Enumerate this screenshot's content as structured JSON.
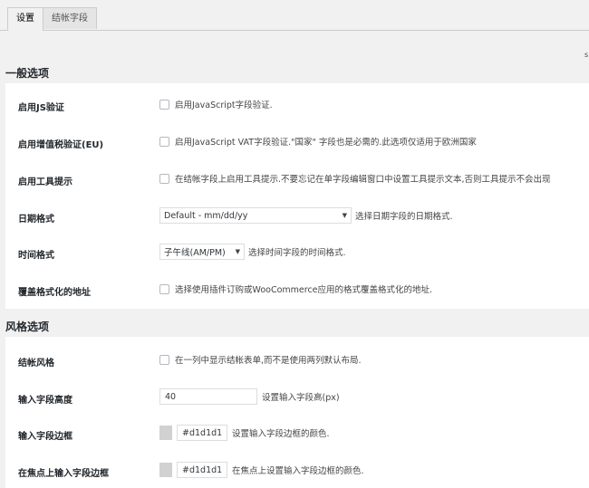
{
  "tabs": [
    {
      "label": "设置",
      "active": true
    },
    {
      "label": "结帐字段",
      "active": false
    }
  ],
  "stray_char": "s",
  "sections": [
    {
      "title": "一般选项",
      "rows": [
        {
          "label": "启用JS验证",
          "type": "checkbox",
          "checked": false,
          "desc": "启用JavaScript字段验证."
        },
        {
          "label": "启用增值税验证(EU)",
          "type": "checkbox",
          "checked": false,
          "desc": "启用JavaScript VAT字段验证.\"国家\" 字段也是必需的.此选项仅适用于欧洲国家"
        },
        {
          "label": "启用工具提示",
          "type": "checkbox",
          "checked": false,
          "desc": "在结帐字段上启用工具提示.不要忘记在单字段编辑窗口中设置工具提示文本,否则工具提示不会出现"
        },
        {
          "label": "日期格式",
          "type": "select",
          "value": "Default - mm/dd/yy",
          "desc": "选择日期字段的日期格式."
        },
        {
          "label": "时间格式",
          "type": "select",
          "value": "子午线(AM/PM)",
          "desc": "选择时间字段的时间格式."
        },
        {
          "label": "覆盖格式化的地址",
          "type": "checkbox",
          "checked": false,
          "desc": "选择使用插件订购或WooCommerce应用的格式覆盖格式化的地址."
        }
      ]
    },
    {
      "title": "风格选项",
      "rows": [
        {
          "label": "结帐风格",
          "type": "checkbox",
          "checked": false,
          "desc": "在一列中显示结帐表单,而不是使用两列默认布局."
        },
        {
          "label": "输入字段高度",
          "type": "input",
          "value": "40",
          "desc": "设置输入字段高(px)"
        },
        {
          "label": "输入字段边框",
          "type": "color",
          "value": "#d1d1d1",
          "desc": "设置输入字段边框的颜色."
        },
        {
          "label": "在焦点上输入字段边框",
          "type": "color",
          "value": "#d1d1d1",
          "desc": "在焦点上设置输入字段边框的颜色."
        }
      ]
    }
  ],
  "colors": {
    "swatch": "#d1d1d1",
    "page_bg": "#f1f1f1",
    "panel_bg": "#ffffff"
  }
}
